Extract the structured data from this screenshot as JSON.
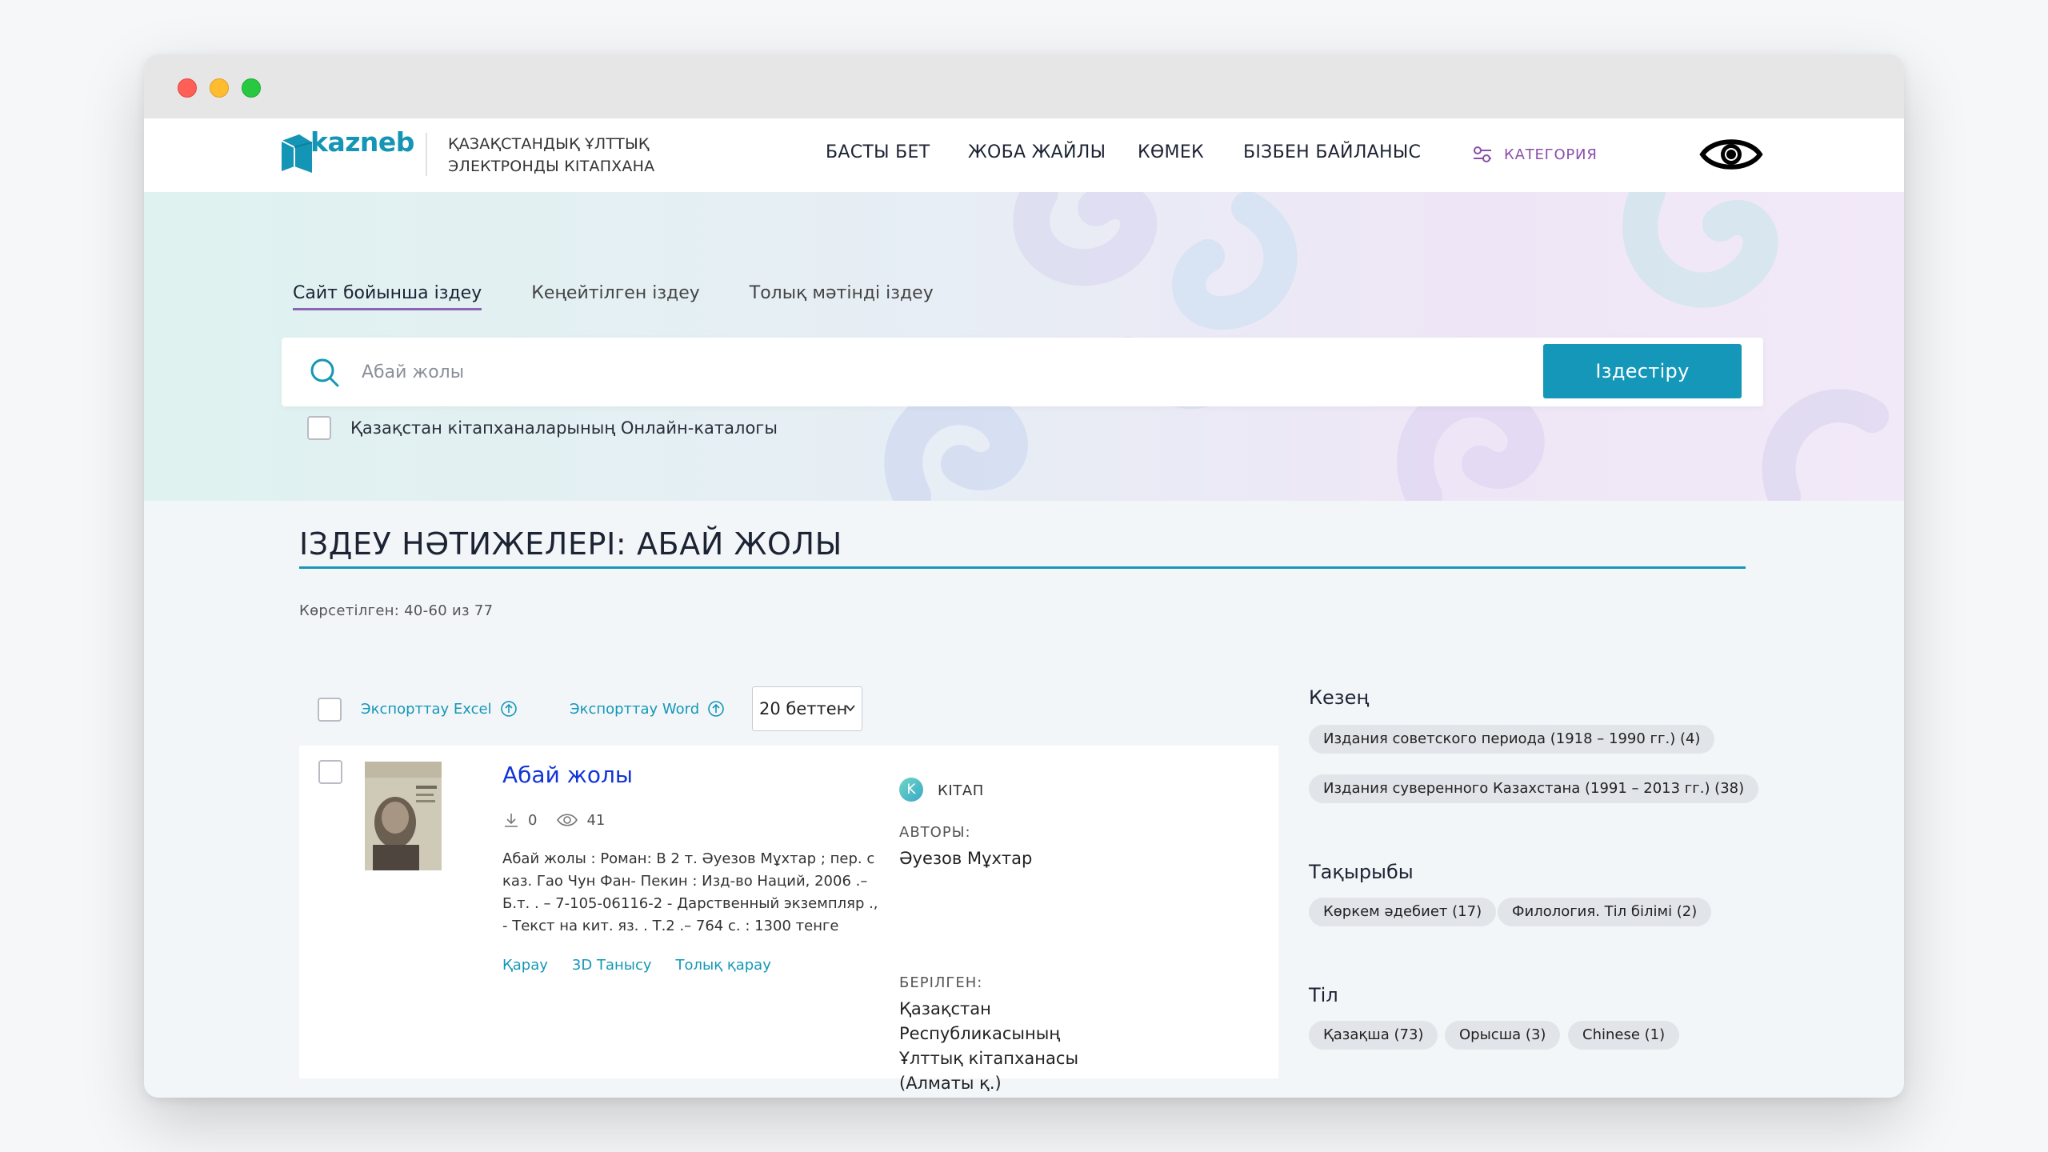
{
  "header": {
    "logo_text": "kazneb",
    "org_line1": "ҚАЗАҚСТАНДЫҚ ҰЛТТЫҚ",
    "org_line2": "ЭЛЕКТРОНДЫ КІТАПХАНА",
    "nav": [
      "БАСТЫ БЕТ",
      "ЖОБА ЖАЙЛЫ",
      "КӨМЕК",
      "БІЗБЕН БАЙЛАНЫС"
    ],
    "category_label": "КАТЕГОРИЯ"
  },
  "search": {
    "tabs": [
      "Сайт бойынша іздеу",
      "Кеңейтілген іздеу",
      "Толық мәтінді іздеу"
    ],
    "active_tab": 0,
    "value": "",
    "placeholder": "Абай жолы",
    "button_label": "Іздестіру",
    "online_catalog_label": "Қазақстан кітапханаларының Онлайн-каталогы"
  },
  "results": {
    "title": "ІЗДЕУ НӘТИЖЕЛЕРІ: АБАЙ ЖОЛЫ",
    "shown": "Көрсетілген: 40-60 из 77",
    "export_excel": "Экспорттау Excel",
    "export_word": "Экспорттау Word",
    "per_page": "20 беттен",
    "items": [
      {
        "title": "Абай жолы",
        "downloads": "0",
        "views": "41",
        "description": "Абай жолы : Роман: В 2 т. Әуезов Мұхтар ; пер. с каз. Гао Чун Фан- Пекин : Изд-во Наций, 2006 .– Б.т. . – 7-105-06116-2 - Дарственный экземпляр ., - Текст на кит. яз. . Т.2 .– 764 с. : 1300 тенге",
        "actions": [
          "Қарау",
          "3D Танысу",
          "Толық қарау"
        ],
        "type_icon_letter": "K",
        "type_label": "КІТАП",
        "authors_label": "АВТОРЫ:",
        "authors": "Әуезов Мұхтар",
        "given_label": "БЕРІЛГЕН:",
        "given": [
          "Қазақстан",
          "Республикасының",
          "Ұлттық кітапханасы",
          "(Алматы қ.)"
        ]
      }
    ]
  },
  "facets": [
    {
      "title": "Кезең",
      "chips": [
        "Издания советского периода (1918 – 1990 гг.) (4)",
        "Издания суверенного Казахстана (1991 – 2013 гг.) (38)"
      ]
    },
    {
      "title": "Тақырыбы",
      "chips": [
        "Көркем әдебиет (17)",
        "Филология. Тіл білімі (2)"
      ]
    },
    {
      "title": "Тіл",
      "chips": [
        "Қазақша (73)",
        "Орысша (3)",
        "Chinese (1)"
      ]
    }
  ],
  "colors": {
    "accent": "#1497b8",
    "link": "#1234d8",
    "category": "#8a4fa8"
  }
}
